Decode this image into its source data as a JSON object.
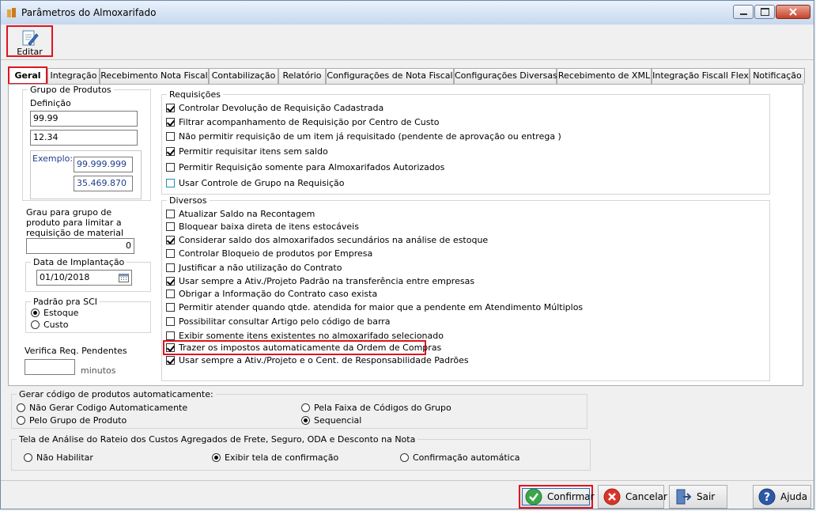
{
  "window": {
    "title": "Parâmetros do Almoxarifado"
  },
  "toolbar": {
    "edit_label": "Editar"
  },
  "tabs": [
    {
      "label": "Geral"
    },
    {
      "label": "Integração"
    },
    {
      "label": "Recebimento Nota Fiscal"
    },
    {
      "label": "Contabilização"
    },
    {
      "label": "Relatório"
    },
    {
      "label": "Configurações de Nota Fiscal"
    },
    {
      "label": "Configurações Diversas"
    },
    {
      "label": "Recebimento de XML"
    },
    {
      "label": "Integração Fiscall Flex"
    },
    {
      "label": "Notificação"
    }
  ],
  "grupo_produtos": {
    "legend": "Grupo de Produtos",
    "definicao_label": "Definição",
    "definicao_1": "99.99",
    "definicao_2": "12.34",
    "exemplo_label": "Exemplo:",
    "exemplo_1": "99.999.999",
    "exemplo_2": "35.469.870"
  },
  "grau": {
    "label": "Grau para grupo de produto para limitar a requisição de material",
    "value": "0"
  },
  "implantacao": {
    "legend": "Data de Implantação",
    "value": "01/10/2018"
  },
  "padrao_sci": {
    "legend": "Padrão pra SCI",
    "options": [
      {
        "label": "Estoque",
        "selected": true
      },
      {
        "label": "Custo",
        "selected": false
      }
    ]
  },
  "verifica": {
    "label": "Verifica Req. Pendentes",
    "value": "",
    "unit": "minutos"
  },
  "requisicoes": {
    "legend": "Requisições",
    "items": [
      {
        "label": "Controlar Devolução de Requisição Cadastrada",
        "checked": true
      },
      {
        "label": "Filtrar acompanhamento de Requisição por Centro de Custo",
        "checked": true
      },
      {
        "label": "Não permitir requisição de um item já requisitado (pendente de aprovação ou entrega )",
        "checked": false
      },
      {
        "label": "Permitir requisitar itens sem saldo",
        "checked": true
      },
      {
        "label": "Permitir Requisição somente para Almoxarifados Autorizados",
        "checked": false
      },
      {
        "label": "Usar Controle de Grupo na Requisição",
        "checked": false
      }
    ]
  },
  "diversos": {
    "legend": "Diversos",
    "items": [
      {
        "label": "Atualizar Saldo na Recontagem",
        "checked": false
      },
      {
        "label": "Bloquear baixa direta de itens estocáveis",
        "checked": false
      },
      {
        "label": "Considerar saldo dos almoxarifados secundários na análise de estoque",
        "checked": true
      },
      {
        "label": "Controlar Bloqueio de produtos por Empresa",
        "checked": false
      },
      {
        "label": "Justificar a não utilização do Contrato",
        "checked": false
      },
      {
        "label": "Usar sempre a Ativ./Projeto Padrão na transferência entre empresas",
        "checked": true
      },
      {
        "label": "Obrigar a Informação do Contrato caso exista",
        "checked": false
      },
      {
        "label": "Permitir atender quando qtde. atendida for maior que a pendente em Atendimento Múltiplos",
        "checked": false
      },
      {
        "label": "Possibilitar consultar Artigo pelo código de barra",
        "checked": false
      },
      {
        "label": "Exibir somente itens existentes no almoxarifado selecionado",
        "checked": false
      },
      {
        "label": "Trazer os impostos automaticamente da Ordem de Compras",
        "checked": true
      },
      {
        "label": "Usar sempre a Ativ./Projeto e o Cent. de Responsabilidade Padrões",
        "checked": true
      }
    ]
  },
  "gerar_codigo": {
    "legend": "Gerar código de produtos automaticamente:",
    "options": [
      {
        "label": "Não Gerar Codigo Automaticamente",
        "selected": false
      },
      {
        "label": "Pela Faixa de Códigos do Grupo",
        "selected": false
      },
      {
        "label": "Pelo Grupo de Produto",
        "selected": false
      },
      {
        "label": "Sequencial",
        "selected": true
      }
    ]
  },
  "rateio": {
    "legend": "Tela de Análise do Rateio dos Custos Agregados de Frete, Seguro, ODA e Desconto na Nota",
    "options": [
      {
        "label": "Não Habilitar",
        "selected": false
      },
      {
        "label": "Exibir tela de confirmação",
        "selected": true
      },
      {
        "label": "Confirmação automática",
        "selected": false
      }
    ]
  },
  "footer": {
    "confirm": "Confirmar",
    "cancel": "Cancelar",
    "exit": "Sair",
    "help": "Ajuda"
  },
  "colors": {
    "highlight": "#e0141e",
    "confirm_green": "#3aa648",
    "cancel_red": "#d9342b",
    "help_blue": "#2b5aa8"
  }
}
